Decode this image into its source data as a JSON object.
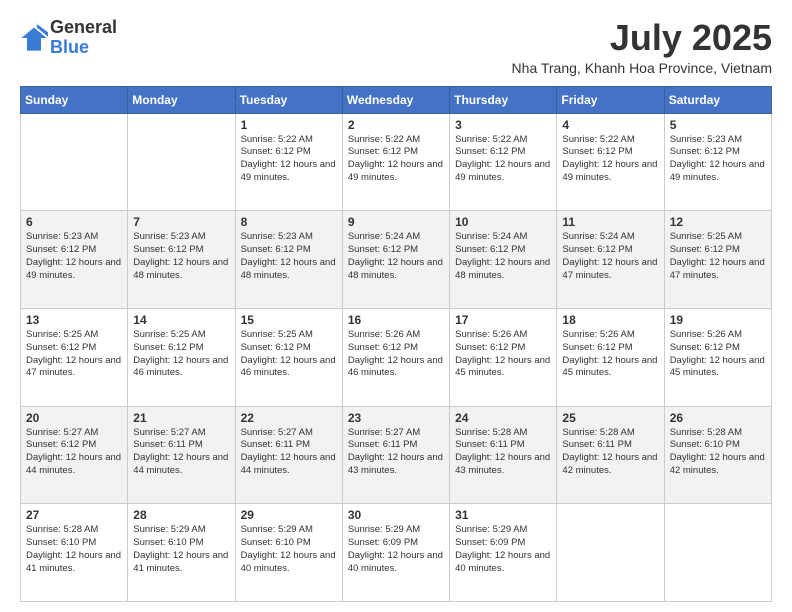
{
  "logo": {
    "general": "General",
    "blue": "Blue"
  },
  "header": {
    "month": "July 2025",
    "location": "Nha Trang, Khanh Hoa Province, Vietnam"
  },
  "days_of_week": [
    "Sunday",
    "Monday",
    "Tuesday",
    "Wednesday",
    "Thursday",
    "Friday",
    "Saturday"
  ],
  "weeks": [
    [
      null,
      null,
      {
        "day": "1",
        "sunrise": "5:22 AM",
        "sunset": "6:12 PM",
        "daylight": "12 hours and 49 minutes."
      },
      {
        "day": "2",
        "sunrise": "5:22 AM",
        "sunset": "6:12 PM",
        "daylight": "12 hours and 49 minutes."
      },
      {
        "day": "3",
        "sunrise": "5:22 AM",
        "sunset": "6:12 PM",
        "daylight": "12 hours and 49 minutes."
      },
      {
        "day": "4",
        "sunrise": "5:22 AM",
        "sunset": "6:12 PM",
        "daylight": "12 hours and 49 minutes."
      },
      {
        "day": "5",
        "sunrise": "5:23 AM",
        "sunset": "6:12 PM",
        "daylight": "12 hours and 49 minutes."
      }
    ],
    [
      {
        "day": "6",
        "sunrise": "5:23 AM",
        "sunset": "6:12 PM",
        "daylight": "12 hours and 49 minutes."
      },
      {
        "day": "7",
        "sunrise": "5:23 AM",
        "sunset": "6:12 PM",
        "daylight": "12 hours and 48 minutes."
      },
      {
        "day": "8",
        "sunrise": "5:23 AM",
        "sunset": "6:12 PM",
        "daylight": "12 hours and 48 minutes."
      },
      {
        "day": "9",
        "sunrise": "5:24 AM",
        "sunset": "6:12 PM",
        "daylight": "12 hours and 48 minutes."
      },
      {
        "day": "10",
        "sunrise": "5:24 AM",
        "sunset": "6:12 PM",
        "daylight": "12 hours and 48 minutes."
      },
      {
        "day": "11",
        "sunrise": "5:24 AM",
        "sunset": "6:12 PM",
        "daylight": "12 hours and 47 minutes."
      },
      {
        "day": "12",
        "sunrise": "5:25 AM",
        "sunset": "6:12 PM",
        "daylight": "12 hours and 47 minutes."
      }
    ],
    [
      {
        "day": "13",
        "sunrise": "5:25 AM",
        "sunset": "6:12 PM",
        "daylight": "12 hours and 47 minutes."
      },
      {
        "day": "14",
        "sunrise": "5:25 AM",
        "sunset": "6:12 PM",
        "daylight": "12 hours and 46 minutes."
      },
      {
        "day": "15",
        "sunrise": "5:25 AM",
        "sunset": "6:12 PM",
        "daylight": "12 hours and 46 minutes."
      },
      {
        "day": "16",
        "sunrise": "5:26 AM",
        "sunset": "6:12 PM",
        "daylight": "12 hours and 46 minutes."
      },
      {
        "day": "17",
        "sunrise": "5:26 AM",
        "sunset": "6:12 PM",
        "daylight": "12 hours and 45 minutes."
      },
      {
        "day": "18",
        "sunrise": "5:26 AM",
        "sunset": "6:12 PM",
        "daylight": "12 hours and 45 minutes."
      },
      {
        "day": "19",
        "sunrise": "5:26 AM",
        "sunset": "6:12 PM",
        "daylight": "12 hours and 45 minutes."
      }
    ],
    [
      {
        "day": "20",
        "sunrise": "5:27 AM",
        "sunset": "6:12 PM",
        "daylight": "12 hours and 44 minutes."
      },
      {
        "day": "21",
        "sunrise": "5:27 AM",
        "sunset": "6:11 PM",
        "daylight": "12 hours and 44 minutes."
      },
      {
        "day": "22",
        "sunrise": "5:27 AM",
        "sunset": "6:11 PM",
        "daylight": "12 hours and 44 minutes."
      },
      {
        "day": "23",
        "sunrise": "5:27 AM",
        "sunset": "6:11 PM",
        "daylight": "12 hours and 43 minutes."
      },
      {
        "day": "24",
        "sunrise": "5:28 AM",
        "sunset": "6:11 PM",
        "daylight": "12 hours and 43 minutes."
      },
      {
        "day": "25",
        "sunrise": "5:28 AM",
        "sunset": "6:11 PM",
        "daylight": "12 hours and 42 minutes."
      },
      {
        "day": "26",
        "sunrise": "5:28 AM",
        "sunset": "6:10 PM",
        "daylight": "12 hours and 42 minutes."
      }
    ],
    [
      {
        "day": "27",
        "sunrise": "5:28 AM",
        "sunset": "6:10 PM",
        "daylight": "12 hours and 41 minutes."
      },
      {
        "day": "28",
        "sunrise": "5:29 AM",
        "sunset": "6:10 PM",
        "daylight": "12 hours and 41 minutes."
      },
      {
        "day": "29",
        "sunrise": "5:29 AM",
        "sunset": "6:10 PM",
        "daylight": "12 hours and 40 minutes."
      },
      {
        "day": "30",
        "sunrise": "5:29 AM",
        "sunset": "6:09 PM",
        "daylight": "12 hours and 40 minutes."
      },
      {
        "day": "31",
        "sunrise": "5:29 AM",
        "sunset": "6:09 PM",
        "daylight": "12 hours and 40 minutes."
      },
      null,
      null
    ]
  ]
}
